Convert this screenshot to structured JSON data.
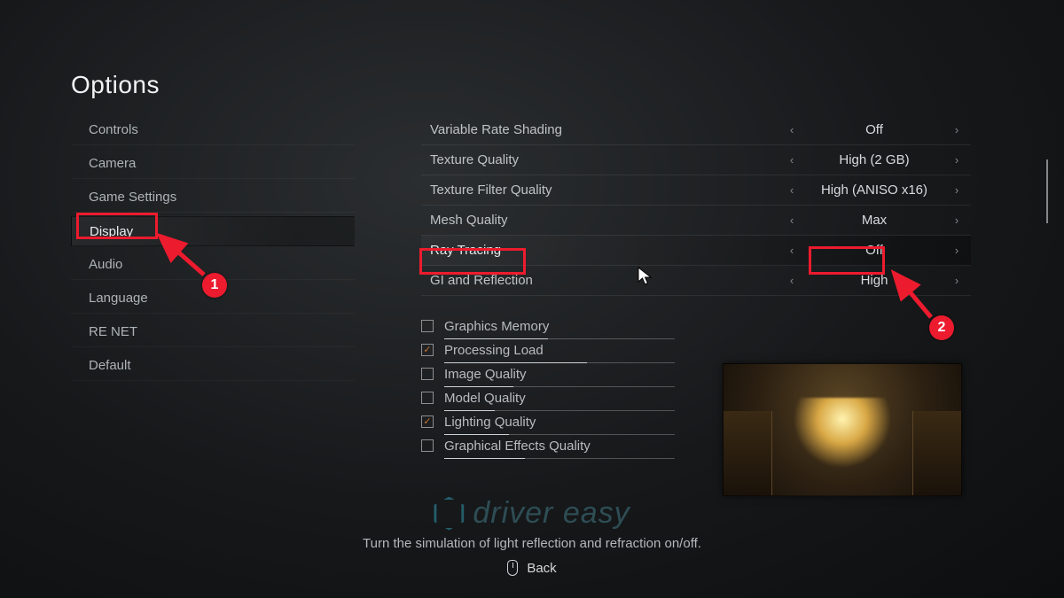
{
  "title": "Options",
  "sidebar": {
    "items": [
      {
        "label": "Controls",
        "selected": false
      },
      {
        "label": "Camera",
        "selected": false
      },
      {
        "label": "Game Settings",
        "selected": false
      },
      {
        "label": "Display",
        "selected": true
      },
      {
        "label": "Audio",
        "selected": false
      },
      {
        "label": "Language",
        "selected": false
      },
      {
        "label": "RE NET",
        "selected": false
      },
      {
        "label": "Default",
        "selected": false
      }
    ]
  },
  "options": [
    {
      "label": "Variable Rate Shading",
      "value": "Off",
      "highlight": false
    },
    {
      "label": "Texture Quality",
      "value": "High (2 GB)",
      "highlight": false
    },
    {
      "label": "Texture Filter Quality",
      "value": "High (ANISO x16)",
      "highlight": false
    },
    {
      "label": "Mesh Quality",
      "value": "Max",
      "highlight": false
    },
    {
      "label": "Ray Tracing",
      "value": "Off",
      "highlight": true
    },
    {
      "label": "GI and Reflection",
      "value": "High",
      "highlight": false
    }
  ],
  "toggles": [
    {
      "label": "Graphics Memory",
      "checked": false,
      "fill": 0.45
    },
    {
      "label": "Processing Load",
      "checked": true,
      "fill": 0.62
    },
    {
      "label": "Image Quality",
      "checked": false,
      "fill": 0.3
    },
    {
      "label": "Model Quality",
      "checked": false,
      "fill": 0.22
    },
    {
      "label": "Lighting Quality",
      "checked": true,
      "fill": 0.28
    },
    {
      "label": "Graphical Effects Quality",
      "checked": false,
      "fill": 0.35
    }
  ],
  "helper_text": "Turn the simulation of light reflection and refraction on/off.",
  "back_label": "Back",
  "watermark": "driver easy",
  "carets": {
    "left": "‹",
    "right": "›"
  },
  "annotations": {
    "badge1": "1",
    "badge2": "2"
  }
}
